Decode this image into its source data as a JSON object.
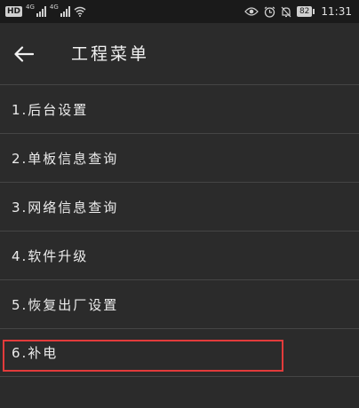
{
  "status_bar": {
    "hd_label": "HD",
    "net_1": "4G",
    "net_2": "4G",
    "battery": "82",
    "time": "11:31",
    "icons": [
      "signal-icon",
      "wifi-icon",
      "eye-icon",
      "alarm-icon",
      "mute-icon",
      "battery-icon"
    ]
  },
  "app_bar": {
    "back_icon": "arrow-left-icon",
    "title": "工程菜单"
  },
  "menu": {
    "items": [
      {
        "label": "1.后台设置"
      },
      {
        "label": "2.单板信息查询"
      },
      {
        "label": "3.网络信息查询"
      },
      {
        "label": "4.软件升级"
      },
      {
        "label": "5.恢复出厂设置"
      },
      {
        "label": "6.补电"
      }
    ]
  },
  "highlight": {
    "color": "#e23b3b"
  }
}
